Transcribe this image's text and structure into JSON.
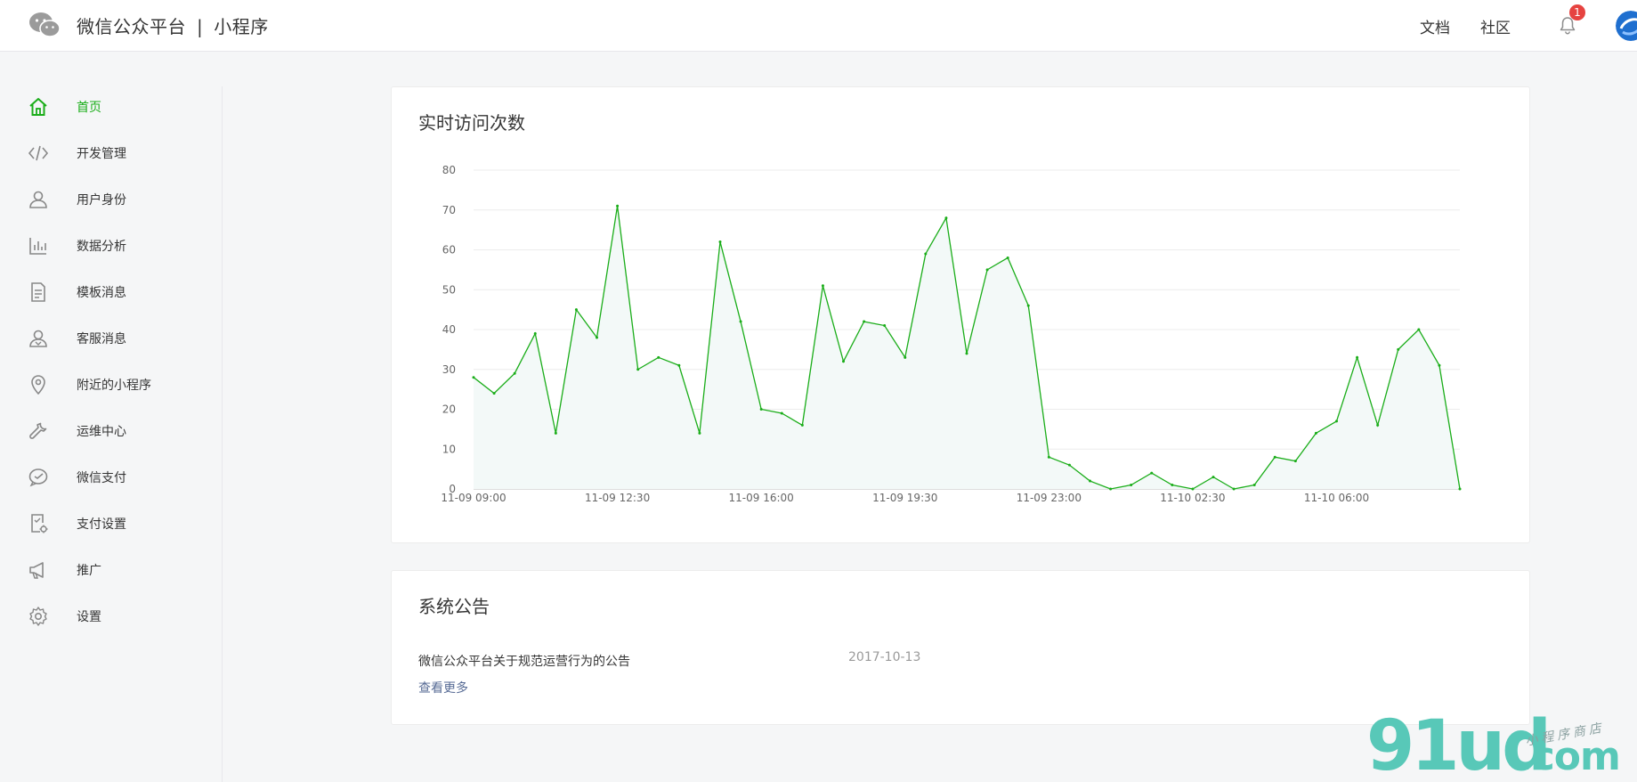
{
  "header": {
    "brand_primary": "微信公众平台",
    "brand_sep": "|",
    "brand_secondary": "小程序",
    "links": [
      "文档",
      "社区"
    ],
    "notification_count": "1"
  },
  "sidebar": {
    "items": [
      {
        "label": "首页",
        "icon": "home-icon",
        "active": true
      },
      {
        "label": "开发管理",
        "icon": "code-icon"
      },
      {
        "label": "用户身份",
        "icon": "user-icon"
      },
      {
        "label": "数据分析",
        "icon": "bar-chart-icon"
      },
      {
        "label": "模板消息",
        "icon": "document-icon"
      },
      {
        "label": "客服消息",
        "icon": "customer-service-icon"
      },
      {
        "label": "附近的小程序",
        "icon": "location-pin-icon"
      },
      {
        "label": "运维中心",
        "icon": "wrench-icon"
      },
      {
        "label": "微信支付",
        "icon": "wechat-pay-icon"
      },
      {
        "label": "支付设置",
        "icon": "payment-settings-icon"
      },
      {
        "label": "推广",
        "icon": "megaphone-icon"
      },
      {
        "label": "设置",
        "icon": "gear-icon"
      }
    ]
  },
  "chart_card": {
    "title": "实时访问次数"
  },
  "chart_data": {
    "type": "area",
    "title": "实时访问次数",
    "x_tick_labels": [
      "11-09 09:00",
      "11-09 12:30",
      "11-09 16:00",
      "11-09 19:30",
      "11-09 23:00",
      "11-10 02:30",
      "11-10 06:00"
    ],
    "x_tick_indices": [
      0,
      7,
      14,
      21,
      28,
      35,
      42
    ],
    "y_ticks": [
      0,
      10,
      20,
      30,
      40,
      50,
      60,
      70,
      80
    ],
    "ylim": [
      0,
      80
    ],
    "line_color": "#1aad19",
    "area_color": "#f3f9f8",
    "values": [
      28,
      24,
      29,
      39,
      14,
      45,
      38,
      71,
      30,
      33,
      31,
      14,
      62,
      42,
      20,
      19,
      16,
      51,
      32,
      42,
      41,
      33,
      59,
      68,
      34,
      55,
      58,
      46,
      8,
      6,
      2,
      0,
      1,
      4,
      1,
      0,
      3,
      0,
      1,
      8,
      7,
      14,
      17,
      33,
      16,
      35,
      40,
      31,
      0
    ]
  },
  "notice_card": {
    "title": "系统公告",
    "items": [
      {
        "text": "微信公众平台关于规范运营行为的公告",
        "date": "2017-10-13"
      }
    ],
    "more_label": "查看更多"
  },
  "watermark": {
    "main": "91ud",
    "suffix": ".com",
    "sub": "小程序商店"
  }
}
